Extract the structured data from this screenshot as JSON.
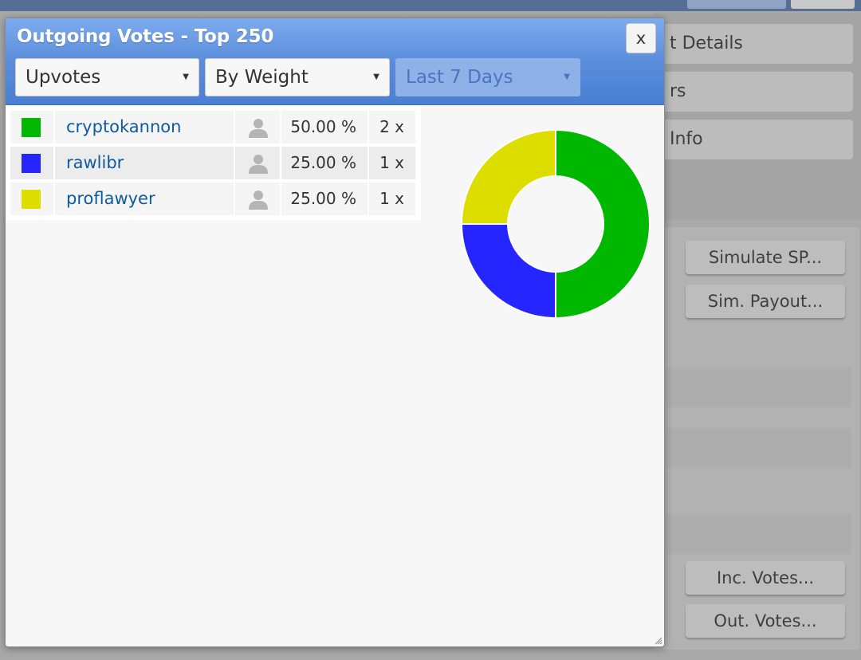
{
  "background": {
    "tabs": [
      "t Details",
      "rs",
      "Info"
    ],
    "buttons": [
      "Simulate SP...",
      "Sim. Payout...",
      "Inc. Votes...",
      "Out. Votes..."
    ]
  },
  "dialog": {
    "title": "Outgoing Votes - Top 250",
    "close_label": "x",
    "selects": {
      "vote_type": "Upvotes",
      "sort": "By Weight",
      "period": "Last 7 Days"
    },
    "rows": [
      {
        "name": "cryptokannon",
        "percent": "50.00 %",
        "count": "2 x",
        "color": "#00b800"
      },
      {
        "name": "rawlibr",
        "percent": "25.00 %",
        "count": "1 x",
        "color": "#2525ff"
      },
      {
        "name": "proflawyer",
        "percent": "25.00 %",
        "count": "1 x",
        "color": "#dddd00"
      }
    ]
  },
  "chart_data": {
    "type": "pie",
    "variant": "donut",
    "categories": [
      "cryptokannon",
      "rawlibr",
      "proflawyer"
    ],
    "values": [
      50,
      25,
      25
    ],
    "colors": [
      "#00b800",
      "#2525ff",
      "#dddd00"
    ]
  }
}
